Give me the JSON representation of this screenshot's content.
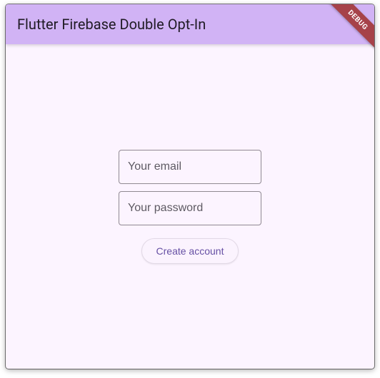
{
  "app_bar": {
    "title": "Flutter Firebase Double Opt-In"
  },
  "debug_ribbon": {
    "label": "DEBUG"
  },
  "form": {
    "email_placeholder": "Your email",
    "password_placeholder": "Your password",
    "submit_label": "Create account"
  }
}
